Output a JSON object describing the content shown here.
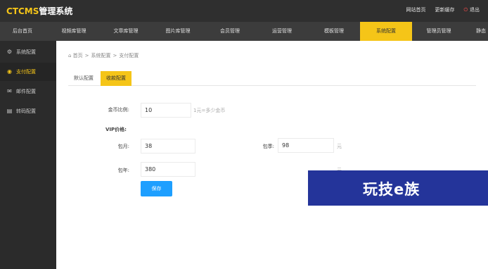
{
  "app": {
    "logo_brand": "CTCMS",
    "logo_suffix": "管理系统"
  },
  "top_links": {
    "site_home": "网站首页",
    "update_cache": "更新缓存",
    "logout": "退出"
  },
  "nav": [
    {
      "label": "后台首页"
    },
    {
      "label": "视频库管理"
    },
    {
      "label": "文章库管理"
    },
    {
      "label": "图片库管理"
    },
    {
      "label": "会员管理"
    },
    {
      "label": "运营管理"
    },
    {
      "label": "模板管理"
    },
    {
      "label": "系统配置"
    },
    {
      "label": "管理员管理"
    },
    {
      "label": "静态"
    }
  ],
  "nav_active": "系统配置",
  "sidebar": [
    {
      "label": "系统配置",
      "icon": "wrench-icon"
    },
    {
      "label": "支付配置",
      "icon": "coin-icon"
    },
    {
      "label": "邮件配置",
      "icon": "mail-icon"
    },
    {
      "label": "转码配置",
      "icon": "film-icon"
    }
  ],
  "sidebar_active": "支付配置",
  "breadcrumb": {
    "home": "首页",
    "section": "系统配置",
    "current": "支付配置"
  },
  "tabs": [
    {
      "label": "默认配置"
    },
    {
      "label": "收款配置"
    }
  ],
  "tab_active": "收款配置",
  "form": {
    "coin_ratio": {
      "label": "金币比例:",
      "value": "10",
      "hint": "1元=多少金币"
    },
    "vip_heading": "VIP价格:",
    "monthly": {
      "label": "包月:",
      "value": "38"
    },
    "quarterly": {
      "label": "包季:",
      "value": "98",
      "unit": "元"
    },
    "yearly": {
      "label": "包年:",
      "value": "380",
      "unit": "元"
    },
    "save_label": "保存"
  },
  "watermark": {
    "text": "玩技e族"
  },
  "colors": {
    "accent": "#f5c518",
    "button": "#1e9fff",
    "topbar": "#2f2f2f",
    "navbar": "#3c3c3c",
    "sidebar": "#2b2b2b",
    "watermark_bg": "#24349a"
  }
}
